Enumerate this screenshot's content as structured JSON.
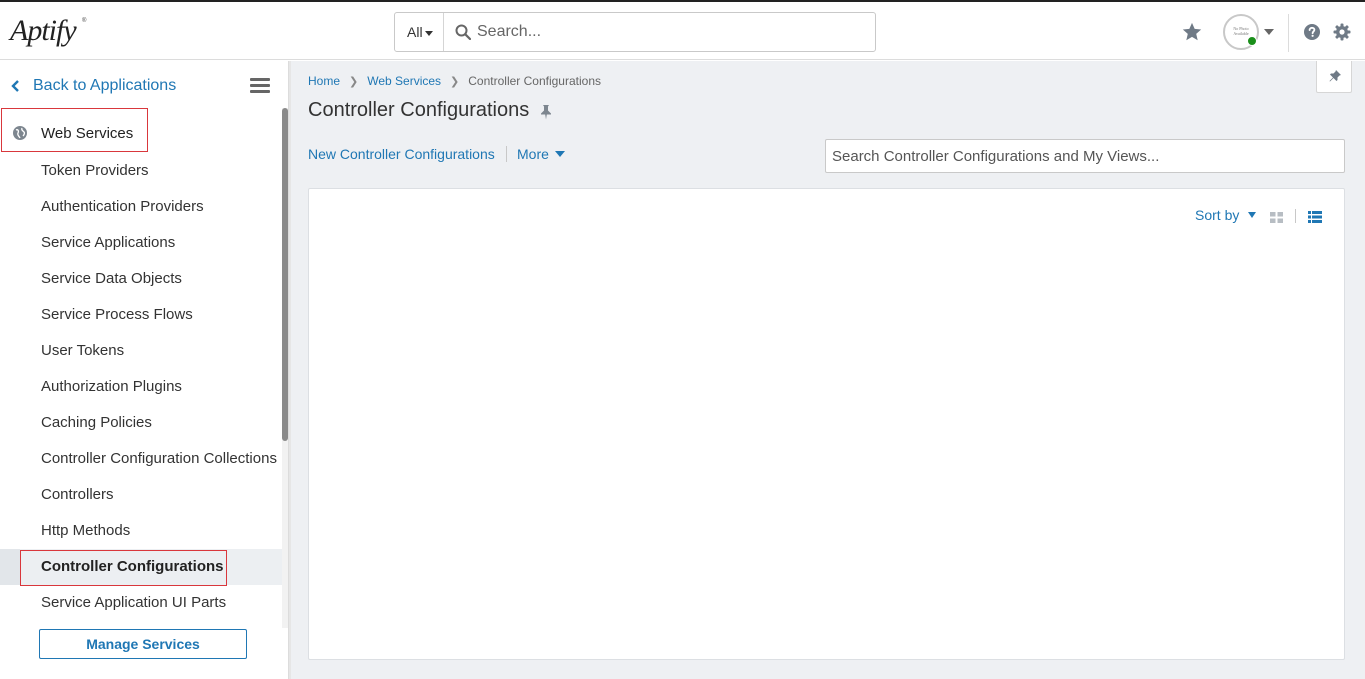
{
  "header": {
    "logo_text": "Aptify",
    "logo_tm": "®",
    "search_scope": "All",
    "search_placeholder": "Search...",
    "avatar_text": "No Photo Available",
    "icons": [
      "star-icon",
      "user-avatar",
      "chevron-down-icon",
      "help-icon",
      "gear-icon"
    ]
  },
  "sidebar": {
    "back_label": "Back to Applications",
    "section_label": "Web Services",
    "items": [
      {
        "label": "Token Providers"
      },
      {
        "label": "Authentication Providers"
      },
      {
        "label": "Service Applications"
      },
      {
        "label": "Service Data Objects"
      },
      {
        "label": "Service Process Flows"
      },
      {
        "label": "User Tokens"
      },
      {
        "label": "Authorization Plugins"
      },
      {
        "label": "Caching Policies"
      },
      {
        "label": "Controller Configuration Collections"
      },
      {
        "label": "Controllers"
      },
      {
        "label": "Http Methods"
      },
      {
        "label": "Controller Configurations"
      },
      {
        "label": "Service Application UI Parts"
      }
    ],
    "active_item": "Controller Configurations",
    "manage_button": "Manage Services"
  },
  "main": {
    "breadcrumb": [
      "Home",
      "Web Services",
      "Controller Configurations"
    ],
    "title": "Controller Configurations",
    "new_link": "New Controller Configurations",
    "more_label": "More",
    "view_search_placeholder": "Search Controller Configurations and My Views...",
    "sort_label": "Sort by"
  },
  "colors": {
    "accent": "#1f77b4",
    "highlight_border": "#d9373c",
    "status_online": "#1a8f1a",
    "content_bg": "#eef0f3"
  }
}
